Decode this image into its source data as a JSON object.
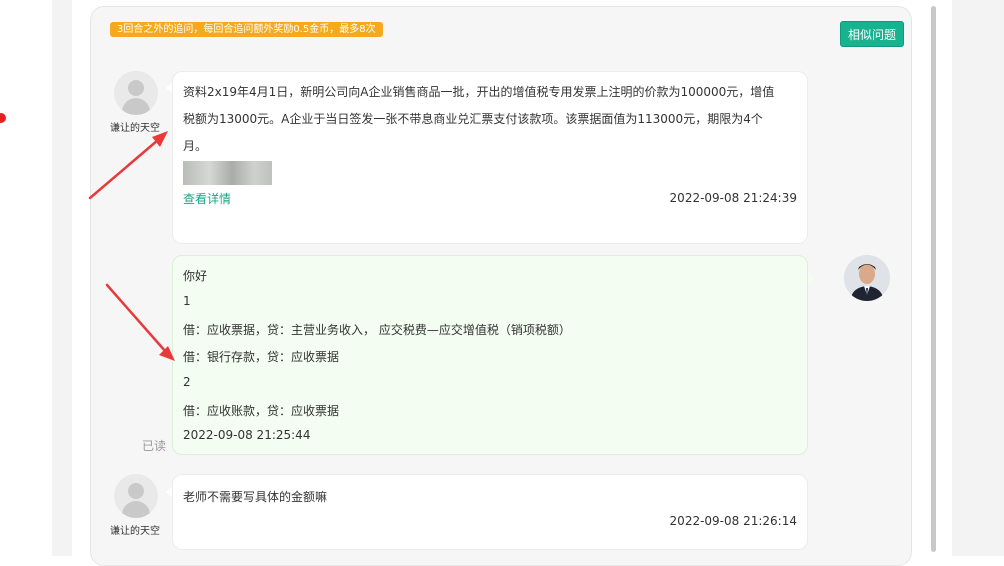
{
  "notice": "3回合之外的追问，每回合追问额外奖励0.5金币，最多8次",
  "similar_button": "相似问题",
  "messages": [
    {
      "user": "谦让的天空",
      "lines": [
        "资料2x19年4月1日，新明公司向A企业销售商品一批，开出的增值税专用发票上注明的价款为100000元，增值",
        "税额为13000元。A企业于当日签发一张不带息商业兑汇票支付该款项。该票据面值为113000元，期限为4个",
        "月。"
      ],
      "link": "查看详情",
      "time": "2022-09-08 21:24:39"
    },
    {
      "lines": [
        "你好",
        "1",
        "借：应收票据，贷：主营业务收入，    应交税费—应交增值税（销项税额）",
        "借：银行存款，贷：应收票据",
        "2",
        "借：应收账款，贷：应收票据"
      ],
      "time": "2022-09-08 21:25:44",
      "status": "已读"
    },
    {
      "user": "谦让的天空",
      "lines": [
        "老师不需要写具体的金额嘛"
      ],
      "time": "2022-09-08 21:26:14"
    }
  ],
  "colors": {
    "accent": "#17b28f",
    "notice": "#f7a91d",
    "arrow": "#e83a3a"
  }
}
